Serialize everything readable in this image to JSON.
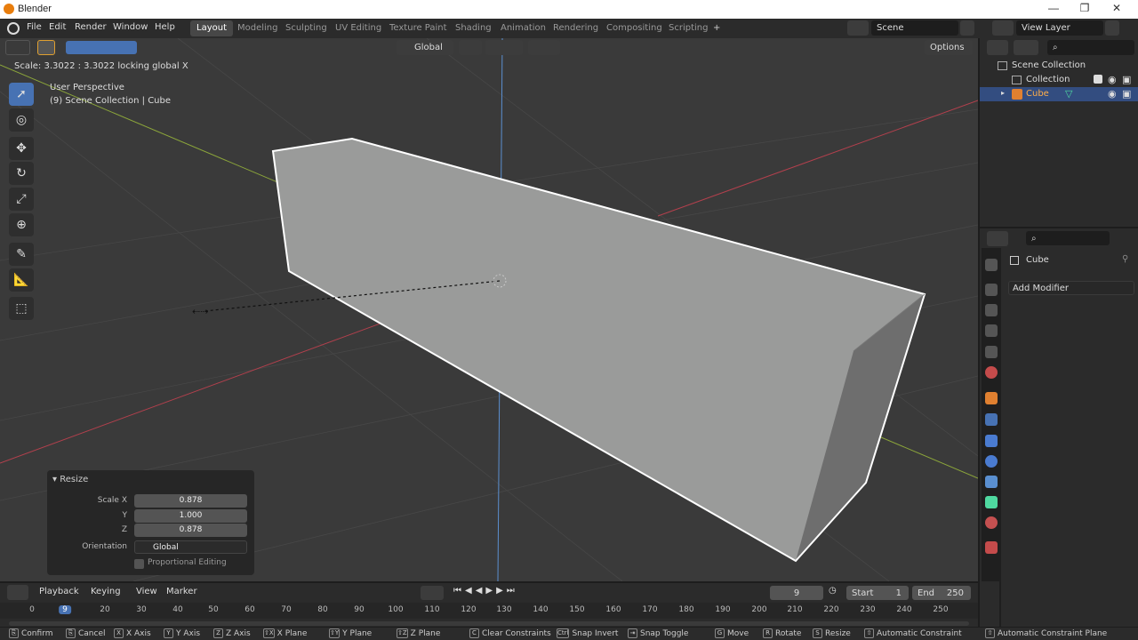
{
  "window": {
    "title": "Blender",
    "minimize": "—",
    "maximize": "❐",
    "close": "✕"
  },
  "menu": [
    "File",
    "Edit",
    "Render",
    "Window",
    "Help"
  ],
  "workspaces": [
    "Layout",
    "Modeling",
    "Sculpting",
    "UV Editing",
    "Texture Paint",
    "Shading",
    "Animation",
    "Rendering",
    "Compositing",
    "Scripting"
  ],
  "workspace_add": "+",
  "scene": {
    "name": "Scene",
    "view_layer": "View Layer"
  },
  "viewport_header": {
    "orientation": "Global",
    "options": "Options"
  },
  "viewport": {
    "status": "Scale: 3.3022 : 3.3022 locking global X",
    "perspective": "User Perspective",
    "collection_info": "(9) Scene Collection | Cube"
  },
  "tools": [
    "select-box-icon",
    "cursor-icon",
    "move-icon",
    "rotate-icon",
    "scale-icon",
    "transform-icon",
    "annotate-icon",
    "measure-icon",
    "add-cube-icon"
  ],
  "resize_panel": {
    "title": "Resize",
    "scale_x_label": "Scale X",
    "scale_x": "0.878",
    "y_label": "Y",
    "y": "1.000",
    "z_label": "Z",
    "z": "0.878",
    "orientation_label": "Orientation",
    "orientation": "Global",
    "proportional": "Proportional Editing"
  },
  "outliner": {
    "scene_collection": "Scene Collection",
    "collection": "Collection",
    "object": "Cube"
  },
  "properties": {
    "object": "Cube",
    "add_modifier": "Add Modifier"
  },
  "timeline": {
    "menus": [
      "Playback",
      "Keying",
      "View",
      "Marker"
    ],
    "current_frame": "9",
    "start_label": "Start",
    "start": "1",
    "end_label": "End",
    "end": "250",
    "ticks": [
      "0",
      "9",
      "20",
      "30",
      "40",
      "50",
      "60",
      "70",
      "80",
      "90",
      "100",
      "110",
      "120",
      "130",
      "140",
      "150",
      "160",
      "170",
      "180",
      "190",
      "200",
      "210",
      "220",
      "230",
      "240",
      "250"
    ]
  },
  "statusbar": [
    {
      "key": "⎘",
      "label": "Confirm"
    },
    {
      "key": "⎘",
      "label": "Cancel"
    },
    {
      "key": "X",
      "label": "X Axis"
    },
    {
      "key": "Y",
      "label": "Y Axis"
    },
    {
      "key": "Z",
      "label": "Z Axis"
    },
    {
      "key": "⇧X",
      "label": "X Plane"
    },
    {
      "key": "⇧Y",
      "label": "Y Plane"
    },
    {
      "key": "⇧Z",
      "label": "Z Plane"
    },
    {
      "key": "C",
      "label": "Clear Constraints"
    },
    {
      "key": "Ctrl",
      "label": "Snap Invert"
    },
    {
      "key": "⇥",
      "label": "Snap Toggle"
    },
    {
      "key": "G",
      "label": "Move"
    },
    {
      "key": "R",
      "label": "Rotate"
    },
    {
      "key": "S",
      "label": "Resize"
    },
    {
      "key": "⇧",
      "label": "Automatic Constraint"
    },
    {
      "key": "⇧",
      "label": "Automatic Constraint Plane"
    }
  ]
}
